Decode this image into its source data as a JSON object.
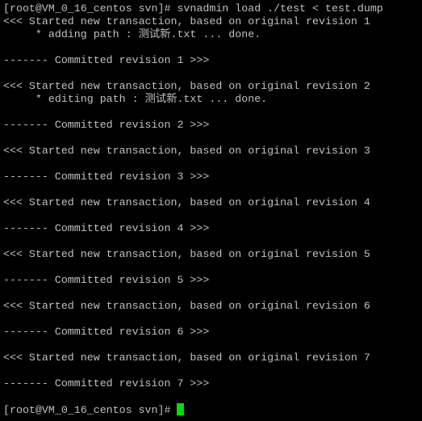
{
  "terminal": {
    "colors": {
      "background": "#000000",
      "text": "#c0c0c0",
      "cursor": "#00e000"
    },
    "lines": [
      "[root@VM_0_16_centos svn]# svnadmin load ./test < test.dump",
      "<<< Started new transaction, based on original revision 1",
      "     * adding path : 测试新.txt ... done.",
      "",
      "------- Committed revision 1 >>>",
      "",
      "<<< Started new transaction, based on original revision 2",
      "     * editing path : 测试新.txt ... done.",
      "",
      "------- Committed revision 2 >>>",
      "",
      "<<< Started new transaction, based on original revision 3",
      "",
      "------- Committed revision 3 >>>",
      "",
      "<<< Started new transaction, based on original revision 4",
      "",
      "------- Committed revision 4 >>>",
      "",
      "<<< Started new transaction, based on original revision 5",
      "",
      "------- Committed revision 5 >>>",
      "",
      "<<< Started new transaction, based on original revision 6",
      "",
      "------- Committed revision 6 >>>",
      "",
      "<<< Started new transaction, based on original revision 7",
      "",
      "------- Committed revision 7 >>>",
      ""
    ],
    "prompt": "[root@VM_0_16_centos svn]# "
  }
}
